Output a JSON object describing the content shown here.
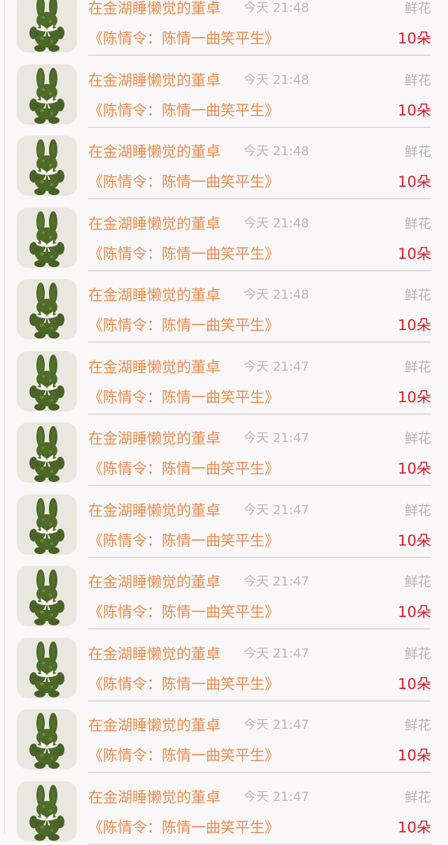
{
  "gift_list": {
    "rows": [
      {
        "name": "在金湖睡懒觉的董卓",
        "time": "今天 21:48",
        "category": "鲜花",
        "work": "《陈情令：陈情一曲笑平生》",
        "amount": "10朵",
        "avatar_icon": "moss-bunny-avatar"
      },
      {
        "name": "在金湖睡懒觉的董卓",
        "time": "今天 21:48",
        "category": "鲜花",
        "work": "《陈情令：陈情一曲笑平生》",
        "amount": "10朵",
        "avatar_icon": "moss-bunny-avatar"
      },
      {
        "name": "在金湖睡懒觉的董卓",
        "time": "今天 21:48",
        "category": "鲜花",
        "work": "《陈情令：陈情一曲笑平生》",
        "amount": "10朵",
        "avatar_icon": "moss-bunny-avatar"
      },
      {
        "name": "在金湖睡懒觉的董卓",
        "time": "今天 21:48",
        "category": "鲜花",
        "work": "《陈情令：陈情一曲笑平生》",
        "amount": "10朵",
        "avatar_icon": "moss-bunny-avatar"
      },
      {
        "name": "在金湖睡懒觉的董卓",
        "time": "今天 21:48",
        "category": "鲜花",
        "work": "《陈情令：陈情一曲笑平生》",
        "amount": "10朵",
        "avatar_icon": "moss-bunny-avatar"
      },
      {
        "name": "在金湖睡懒觉的董卓",
        "time": "今天 21:47",
        "category": "鲜花",
        "work": "《陈情令：陈情一曲笑平生》",
        "amount": "10朵",
        "avatar_icon": "moss-bunny-avatar"
      },
      {
        "name": "在金湖睡懒觉的董卓",
        "time": "今天 21:47",
        "category": "鲜花",
        "work": "《陈情令：陈情一曲笑平生》",
        "amount": "10朵",
        "avatar_icon": "moss-bunny-avatar"
      },
      {
        "name": "在金湖睡懒觉的董卓",
        "time": "今天 21:47",
        "category": "鲜花",
        "work": "《陈情令：陈情一曲笑平生》",
        "amount": "10朵",
        "avatar_icon": "moss-bunny-avatar"
      },
      {
        "name": "在金湖睡懒觉的董卓",
        "time": "今天 21:47",
        "category": "鲜花",
        "work": "《陈情令：陈情一曲笑平生》",
        "amount": "10朵",
        "avatar_icon": "moss-bunny-avatar"
      },
      {
        "name": "在金湖睡懒觉的董卓",
        "time": "今天 21:47",
        "category": "鲜花",
        "work": "《陈情令：陈情一曲笑平生》",
        "amount": "10朵",
        "avatar_icon": "moss-bunny-avatar"
      },
      {
        "name": "在金湖睡懒觉的董卓",
        "time": "今天 21:47",
        "category": "鲜花",
        "work": "《陈情令：陈情一曲笑平生》",
        "amount": "10朵",
        "avatar_icon": "moss-bunny-avatar"
      },
      {
        "name": "在金湖睡懒觉的董卓",
        "time": "今天 21:47",
        "category": "鲜花",
        "work": "《陈情令：陈情一曲笑平生》",
        "amount": "10朵",
        "avatar_icon": "moss-bunny-avatar"
      }
    ]
  },
  "colors": {
    "name_text": "#ea8d52",
    "time_text": "#b9b9b9",
    "category_text": "#b6b6b6",
    "amount_text": "#d51e2c",
    "background": "#f9f7f7"
  }
}
